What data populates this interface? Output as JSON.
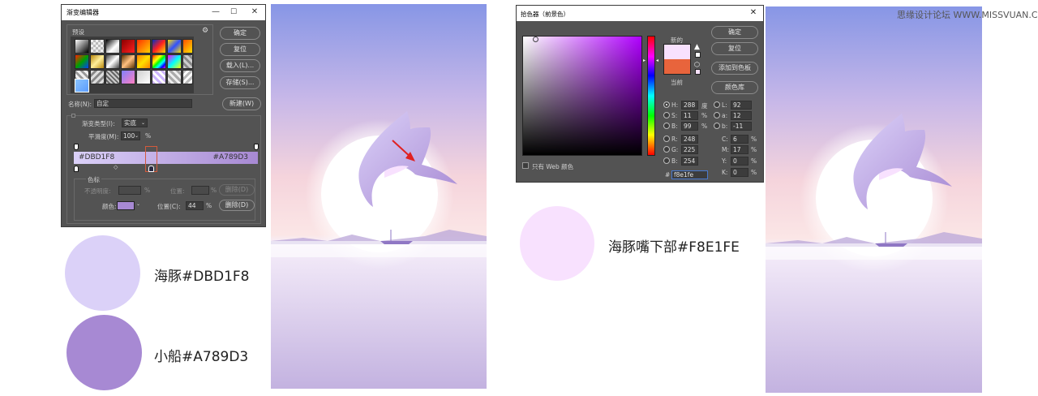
{
  "gradient_editor": {
    "title": "渐变编辑器",
    "controls": {
      "minimize": "—",
      "maximize": "☐",
      "close": "✕"
    },
    "presets_label": "预设",
    "buttons": {
      "ok": "确定",
      "reset": "复位",
      "load": "载入(L)...",
      "save": "存储(S)...",
      "new": "新建(W)",
      "delete": "删除(D)"
    },
    "name_label": "名称(N):",
    "name_value": "自定",
    "type_label": "渐变类型(I):",
    "type_value": "实底",
    "smoothness_label": "平滑度(M):",
    "smoothness_value": "100",
    "smoothness_unit": "%",
    "stop_left_label": "#DBD1F8",
    "stop_right_label": "#A789D3",
    "gradient_from": "#dbd1f8",
    "gradient_to": "#a789d3",
    "stops_group_label": "色标",
    "opacity_label": "不透明度:",
    "opacity_unit": "%",
    "location_label": "位置:",
    "location_unit": "%",
    "color_label": "颜色:",
    "color_location_label": "位置(C):",
    "color_location_value": "44",
    "color_location_unit": "%",
    "current_stop_color": "#a789d3"
  },
  "swatches_left": [
    {
      "color": "#dbd1f8",
      "label": "海豚#DBD1F8"
    },
    {
      "color": "#a789d3",
      "label": "小船#A789D3"
    }
  ],
  "color_picker": {
    "title": "拾色器（前景色）",
    "new_label": "新的",
    "current_label": "当前",
    "new_color": "#f8e1fe",
    "current_color": "#e8643c",
    "buttons": {
      "ok": "确定",
      "reset": "复位",
      "add_swatch": "添加到色板",
      "color_library": "颜色库"
    },
    "web_only_label": "只有 Web 颜色",
    "fields": [
      {
        "label": "H:",
        "value": "288",
        "unit": "度"
      },
      {
        "label": "S:",
        "value": "11",
        "unit": "%"
      },
      {
        "label": "B:",
        "value": "99",
        "unit": "%"
      },
      {
        "label": "R:",
        "value": "248",
        "unit": ""
      },
      {
        "label": "G:",
        "value": "225",
        "unit": ""
      },
      {
        "label": "B:",
        "value": "254",
        "unit": ""
      }
    ],
    "lab_fields": [
      {
        "label": "L:",
        "value": "92"
      },
      {
        "label": "a:",
        "value": "12"
      },
      {
        "label": "b:",
        "value": "-11"
      }
    ],
    "cmyk_fields": [
      {
        "label": "C:",
        "value": "6",
        "unit": "%"
      },
      {
        "label": "M:",
        "value": "17",
        "unit": "%"
      },
      {
        "label": "Y:",
        "value": "0",
        "unit": "%"
      },
      {
        "label": "K:",
        "value": "0",
        "unit": "%"
      }
    ],
    "hex_label": "#",
    "hex_value": "f8e1fe"
  },
  "swatch_right": {
    "color": "#f8e1fe",
    "label": "海豚嘴下部#F8E1FE"
  },
  "watermark": "思缘设计论坛 WWW.MISSVUAN.COM"
}
